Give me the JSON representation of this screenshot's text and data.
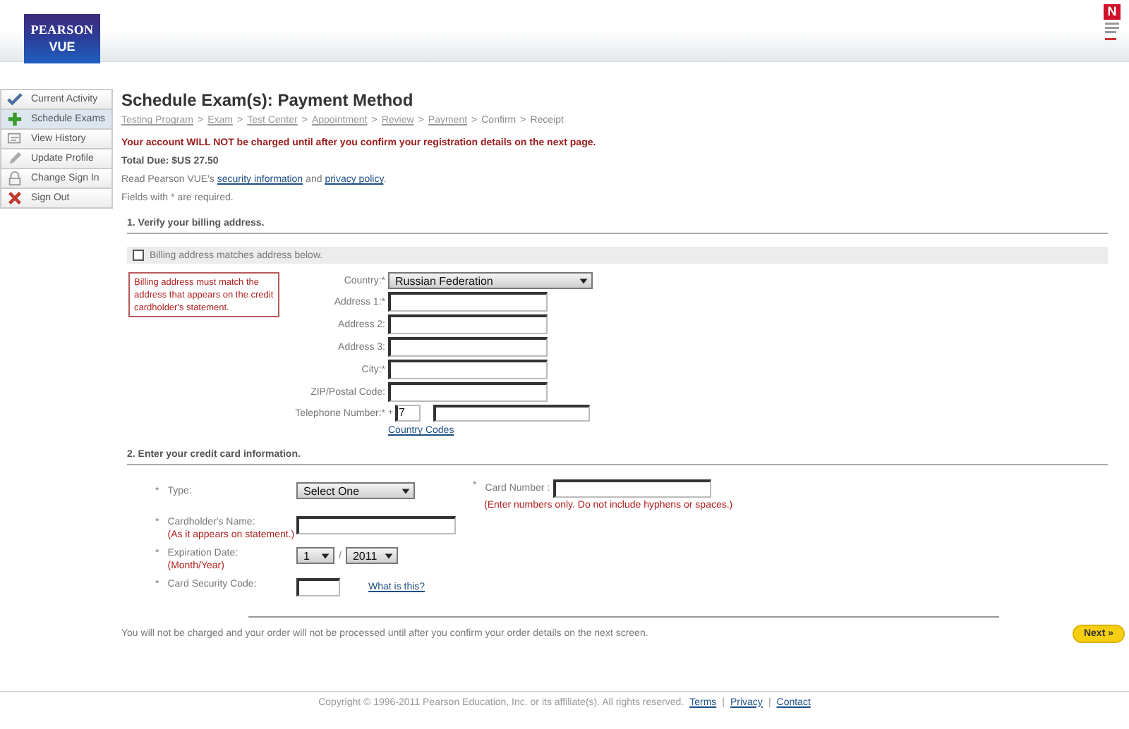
{
  "header": {
    "logo_top": "PEARSON",
    "logo_bottom": "VUE",
    "badge": "N"
  },
  "sidebar": {
    "items": [
      {
        "label": "Current Activity",
        "kind": "check",
        "selected": false
      },
      {
        "label": "Schedule Exams",
        "kind": "plus",
        "selected": true
      },
      {
        "label": "View History",
        "kind": "history",
        "selected": false
      },
      {
        "label": "Update Profile",
        "kind": "pencil",
        "selected": false
      },
      {
        "label": "Change Sign In",
        "kind": "lock",
        "selected": false
      },
      {
        "label": "Sign Out",
        "kind": "cross",
        "selected": false
      }
    ]
  },
  "title": "Schedule Exam(s): Payment Method",
  "breadcrumb": {
    "separator": ">",
    "steps": [
      {
        "label": "Testing Program",
        "kind": "link"
      },
      {
        "label": "Exam",
        "kind": "link"
      },
      {
        "label": "Test Center",
        "kind": "link"
      },
      {
        "label": "Appointment",
        "kind": "link"
      },
      {
        "label": "Review",
        "kind": "link"
      },
      {
        "label": "Payment",
        "kind": "link"
      },
      {
        "label": "Confirm",
        "kind": "plain"
      },
      {
        "label": "Receipt",
        "kind": "plain"
      }
    ]
  },
  "warning": "Your account **WILL NOT** be charged until after you confirm your registration details on the next page.",
  "total_due": "Total Due: $US 27.50",
  "info_line": [
    {
      "text": "Read Pearson VUE's",
      "kind": "text"
    },
    {
      "text": "security information",
      "kind": "link"
    },
    {
      "text": "and",
      "kind": "text"
    },
    {
      "text": "privacy policy",
      "kind": "link"
    },
    {
      "text": ".",
      "kind": "text"
    }
  ],
  "required_note": "Fields with * are required.",
  "billing": {
    "heading": "1. Verify your billing address.",
    "same_address": {
      "label": "Billing address matches address below.",
      "checked": false
    },
    "notice": "Billing address must match the address that appears on the credit cardholder's statement.",
    "fields": [
      {
        "label": "Country:*",
        "kind": "select",
        "value": "Russian Federation"
      },
      {
        "label": "Address 1:*",
        "kind": "text"
      },
      {
        "label": "Address 2:",
        "kind": "text"
      },
      {
        "label": "Address 3:",
        "kind": "text"
      },
      {
        "label": "City:*",
        "kind": "text"
      },
      {
        "label": "ZIP/Postal Code:",
        "kind": "text"
      },
      {
        "label": "Telephone Number:*",
        "kind": "phone",
        "prefix": "+",
        "code": "7"
      }
    ],
    "country_codes_link": "Country Codes"
  },
  "card": {
    "heading": "2. Enter your credit card information.",
    "type": {
      "star": "*",
      "label": "Type:",
      "value": "Select One"
    },
    "number": {
      "star": "*",
      "label": "Card Number :",
      "hint": "(Enter numbers only. Do not include hyphens or spaces.)"
    },
    "holder": {
      "star": "*",
      "label": "Cardholder's Name:",
      "hint": "(As it appears on statement.)"
    },
    "expiration": {
      "star": "*",
      "label": "Expiration Date:",
      "hint": "(Month/Year)",
      "month": "1",
      "separator": "/",
      "year": "2011"
    },
    "security": {
      "star": "*",
      "label": "Card Security Code:",
      "link": "What is this?"
    }
  },
  "bottom_note": "You will not be charged and your order will not be processed until after you confirm your order details on the next screen.",
  "next_button": "Next »",
  "footer": {
    "copyright": "Copyright © 1996-2011 Pearson Education, Inc. or its affiliate(s). All rights reserved.",
    "links": [
      "Terms",
      "Privacy",
      "Contact"
    ],
    "separator": "|"
  }
}
